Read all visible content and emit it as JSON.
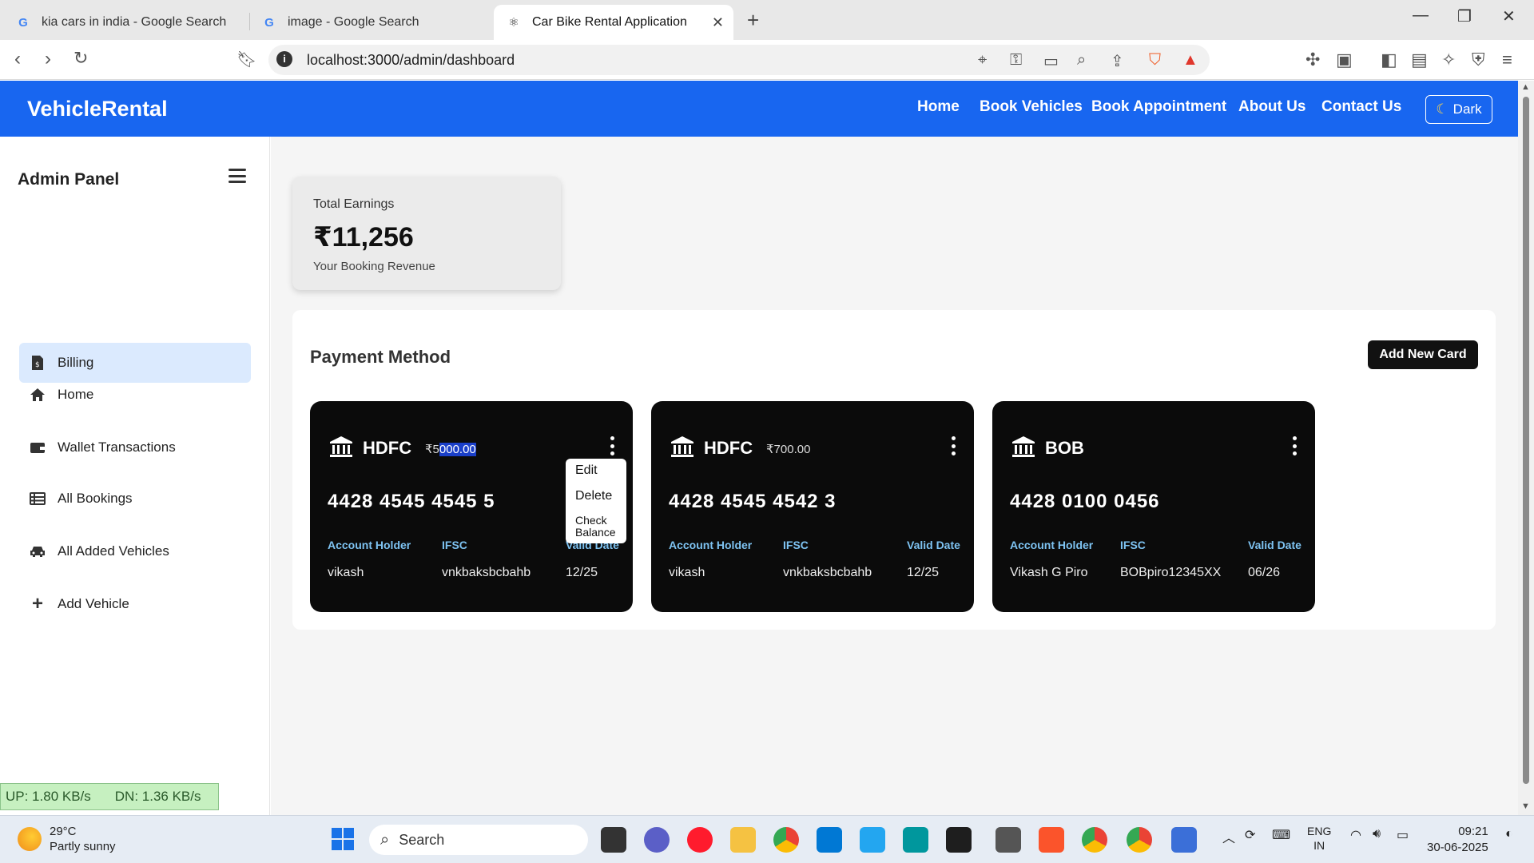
{
  "browser": {
    "tabs": [
      {
        "title": "kia cars in india - Google Search"
      },
      {
        "title": "image - Google Search"
      },
      {
        "title": "Car Bike Rental Application"
      }
    ],
    "url": "localhost:3000/admin/dashboard"
  },
  "navbar": {
    "brand": "VehicleRental",
    "links": [
      "Home",
      "Book Vehicles",
      "Book Appointment",
      "About Us",
      "Contact Us"
    ],
    "dark_label": "Dark"
  },
  "sidebar": {
    "title": "Admin Panel",
    "items": [
      {
        "label": "Home",
        "icon": "home-icon"
      },
      {
        "label": "Wallet Transactions",
        "icon": "wallet-icon"
      },
      {
        "label": "Billing",
        "icon": "billing-icon",
        "active": true
      },
      {
        "label": "All Bookings",
        "icon": "list-icon"
      },
      {
        "label": "All Added Vehicles",
        "icon": "car-icon"
      },
      {
        "label": "Add Vehicle",
        "icon": "plus-icon"
      }
    ]
  },
  "earnings": {
    "label": "Total Earnings",
    "amount": "₹11,256",
    "sub": "Your Booking Revenue"
  },
  "payment": {
    "title": "Payment Method",
    "add_button": "Add New Card",
    "labels": {
      "holder": "Account Holder",
      "ifsc": "IFSC",
      "valid": "Valid Date"
    },
    "cards": [
      {
        "bank": "HDFC",
        "balance_prefix": "₹5",
        "balance_selected": "000.00",
        "number": "4428 4545 4545 5",
        "holder": "vikash",
        "ifsc": "vnkbaksbcbahb",
        "valid": "12/25"
      },
      {
        "bank": "HDFC",
        "balance": "₹700.00",
        "number": "4428 4545 4542 3",
        "holder": "vikash",
        "ifsc": "vnkbaksbcbahb",
        "valid": "12/25"
      },
      {
        "bank": "BOB",
        "balance": "",
        "number": "4428 0100 0456",
        "holder": "Vikash G Piro",
        "ifsc": "BOBpiro12345XX",
        "valid": "06/26"
      }
    ],
    "context_menu": {
      "edit": "Edit",
      "delete": "Delete",
      "check1": "Check",
      "check2": "Balance"
    }
  },
  "netspeed": {
    "up": "UP: 1.80 KB/s",
    "dn": "DN: 1.36 KB/s"
  },
  "taskbar": {
    "weather_temp": "29°C",
    "weather_desc": "Partly sunny",
    "search": "Search",
    "lang1": "ENG",
    "lang2": "IN",
    "time": "09:21",
    "date": "30-06-2025"
  }
}
